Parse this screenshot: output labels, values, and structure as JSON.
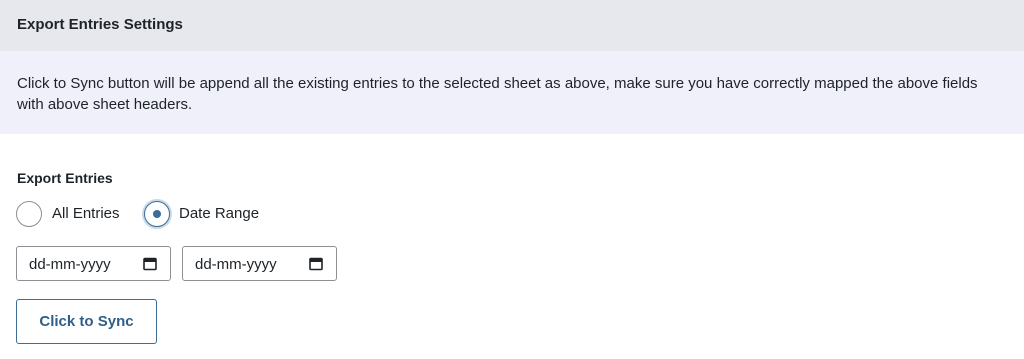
{
  "panel": {
    "title": "Export Entries Settings"
  },
  "notice": {
    "text": "Click to Sync button will be append all the existing entries to the selected sheet as above, make sure you have correctly mapped the above fields with above sheet headers."
  },
  "export": {
    "label": "Export Entries",
    "options": [
      {
        "label": "All Entries",
        "selected": false
      },
      {
        "label": "Date Range",
        "selected": true
      }
    ],
    "date_from": {
      "placeholder": "dd-mm-yyyy",
      "icon": "calendar-icon"
    },
    "date_to": {
      "placeholder": "dd-mm-yyyy",
      "icon": "calendar-icon"
    }
  },
  "actions": {
    "sync_label": "Click to Sync"
  },
  "colors": {
    "header_bg": "#e7e8ee",
    "notice_bg": "#f0f0fa",
    "accent": "#3c6d96"
  }
}
